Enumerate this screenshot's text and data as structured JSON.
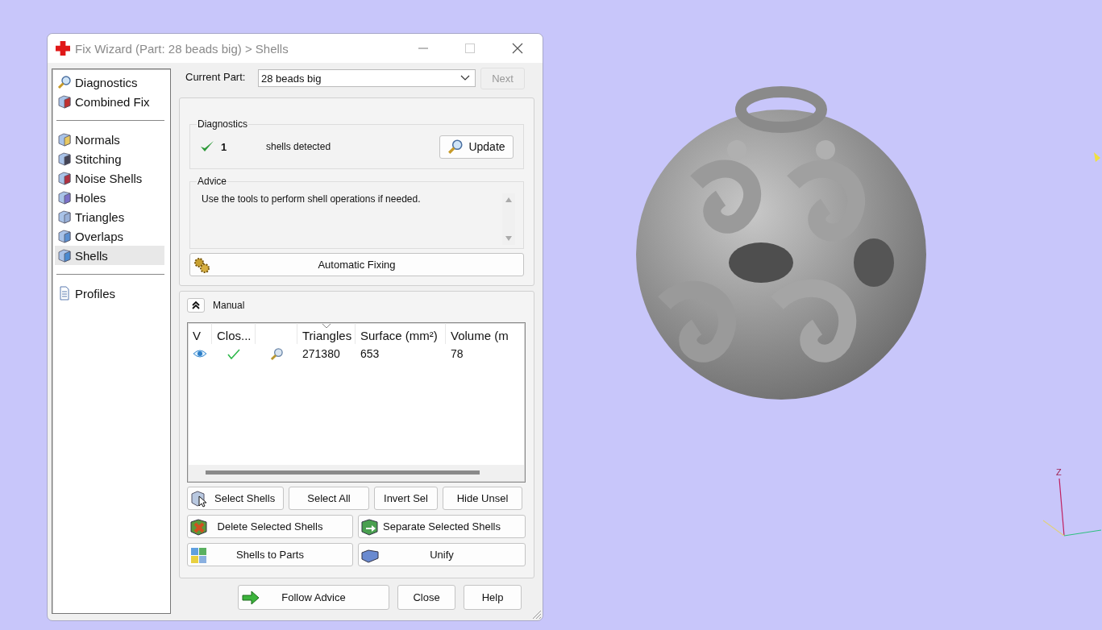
{
  "window": {
    "title": "Fix Wizard (Part: 28 beads big) > Shells"
  },
  "sidebar": {
    "groups": [
      [
        {
          "label": "Diagnostics",
          "kind": "magnifier",
          "selected": false
        },
        {
          "label": "Combined Fix",
          "kind": "cube",
          "selected": false
        }
      ],
      [
        {
          "label": "Normals",
          "kind": "cube",
          "selected": false
        },
        {
          "label": "Stitching",
          "kind": "cube",
          "selected": false
        },
        {
          "label": "Noise Shells",
          "kind": "cube",
          "selected": false
        },
        {
          "label": "Holes",
          "kind": "cube",
          "selected": false
        },
        {
          "label": "Triangles",
          "kind": "cube",
          "selected": false
        },
        {
          "label": "Overlaps",
          "kind": "cube",
          "selected": false
        },
        {
          "label": "Shells",
          "kind": "cube",
          "selected": true
        }
      ],
      [
        {
          "label": "Profiles",
          "kind": "page",
          "selected": false
        }
      ]
    ]
  },
  "current_part": {
    "label": "Current Part:",
    "value": "28 beads big",
    "next": {
      "label": "Next",
      "disabled": true
    }
  },
  "diagnostics": {
    "title": "Diagnostics",
    "ok": true,
    "count": "1",
    "text": "shells detected",
    "button": "Update"
  },
  "advice": {
    "title": "Advice",
    "text": "Use the tools to perform shell operations if needed.",
    "button": "Automatic Fixing"
  },
  "manual": {
    "title": "Manual",
    "expanded": true,
    "table": {
      "columns": [
        {
          "label": "V"
        },
        {
          "label": "Clos..."
        },
        {
          "kind": "blank"
        },
        {
          "label": "Triangles",
          "sorted": true
        },
        {
          "label": "Surface (mm²)"
        },
        {
          "label": "Volume (m"
        }
      ],
      "rows": [
        {
          "visible": true,
          "closed": true,
          "cells": [
            "",
            "",
            "",
            "271380",
            "653",
            "78"
          ]
        }
      ]
    },
    "buttons": [
      [
        {
          "label": "Select Shells",
          "kind": "select"
        },
        {
          "label": "Select All"
        },
        {
          "label": "Invert Sel"
        },
        {
          "label": "Hide Unsel"
        }
      ],
      [
        {
          "label": "Delete Selected Shells",
          "kind": "delete"
        },
        {
          "label": "Separate Selected Shells",
          "kind": "separate"
        }
      ],
      [
        {
          "label": "Shells to Parts",
          "kind": "parts"
        },
        {
          "label": "Unify",
          "kind": "unify"
        }
      ]
    ]
  },
  "footer": {
    "buttons": [
      {
        "label": "Follow Advice",
        "kind": "arrow"
      },
      {
        "label": "Close"
      },
      {
        "label": "Help"
      }
    ]
  },
  "viewport": {
    "axes": [
      {
        "label": "Z"
      }
    ]
  }
}
